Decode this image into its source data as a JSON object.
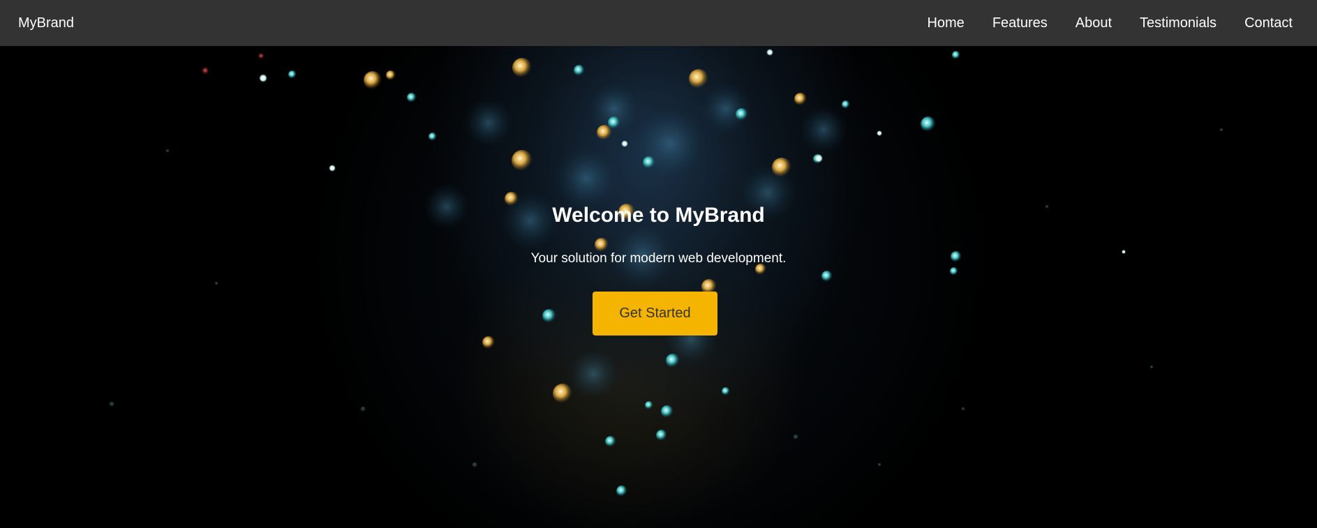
{
  "navbar": {
    "brand": "MyBrand",
    "links": [
      "Home",
      "Features",
      "About",
      "Testimonials",
      "Contact"
    ]
  },
  "hero": {
    "title": "Welcome to MyBrand",
    "subtitle": "Your solution for modern web development.",
    "cta_label": "Get Started",
    "background": "dark bokeh glitter image"
  },
  "colors": {
    "navbar_bg": "#333333",
    "cta_bg": "#f4b400",
    "cta_text": "#333333",
    "text": "#ffffff"
  }
}
